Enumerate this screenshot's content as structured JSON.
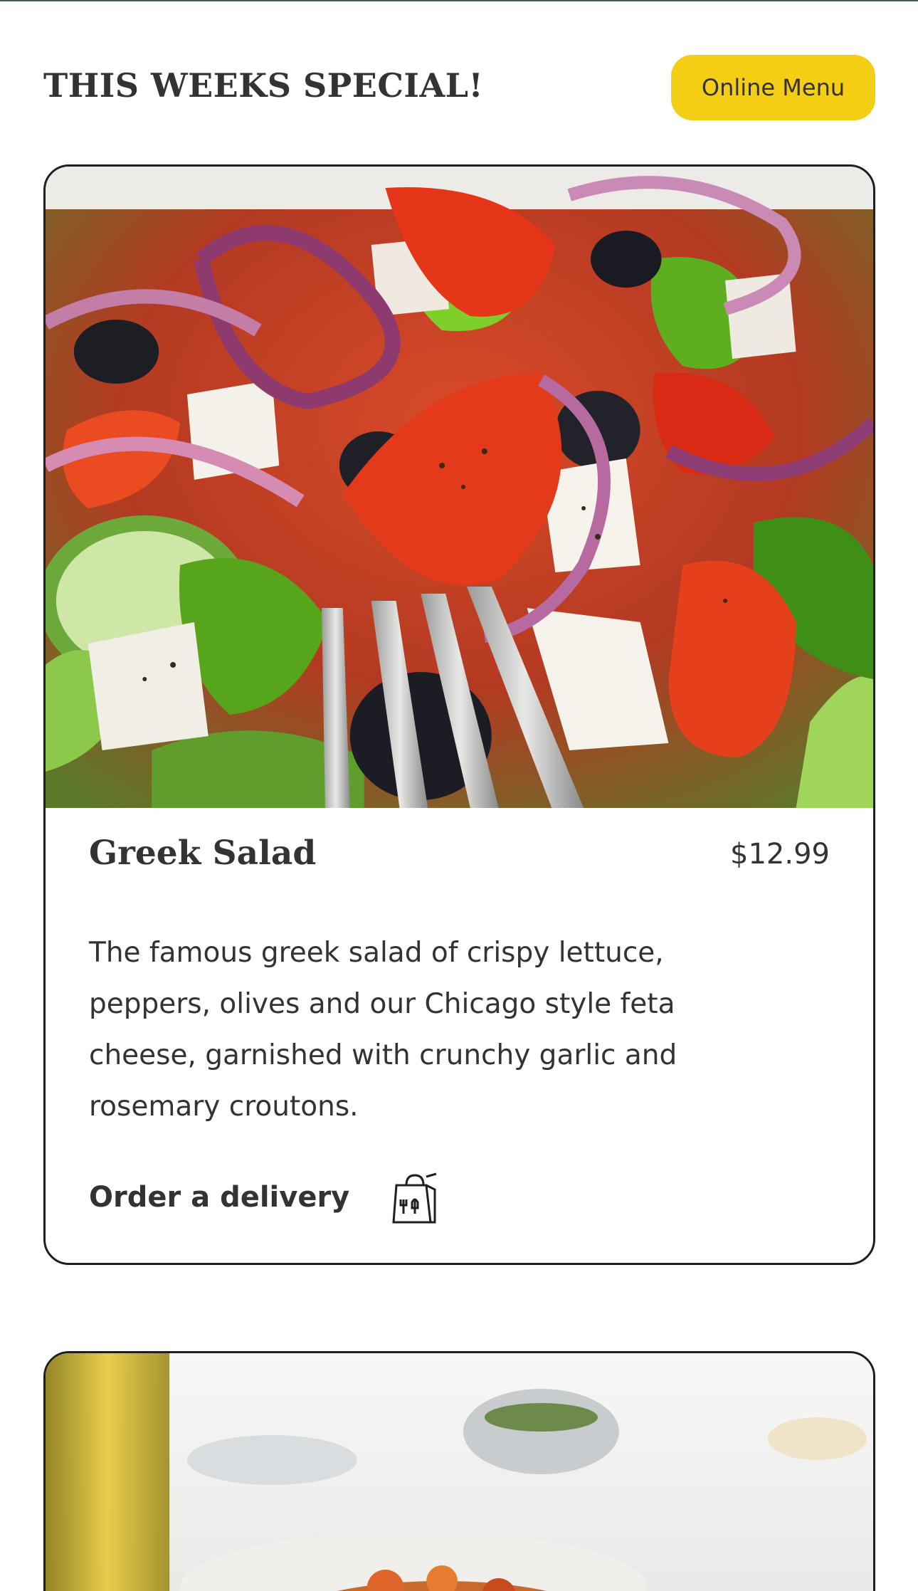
{
  "header": {
    "section_title": "THIS WEEKS SPECIAL!",
    "menu_button_label": "Online Menu"
  },
  "colors": {
    "accent_yellow": "#f4ce14",
    "text_dark": "#333333",
    "border": "#1f1f1f"
  },
  "specials": [
    {
      "name": "Greek Salad",
      "price": "$12.99",
      "description": "The famous greek salad of crispy lettuce, peppers, olives and our Chicago style feta cheese, garnished with crunchy garlic and rosemary croutons.",
      "order_label": "Order a delivery",
      "order_icon": "delivery-bag-icon",
      "photo": "greek-salad-photo"
    },
    {
      "photo": "bruschetta-photo"
    }
  ]
}
